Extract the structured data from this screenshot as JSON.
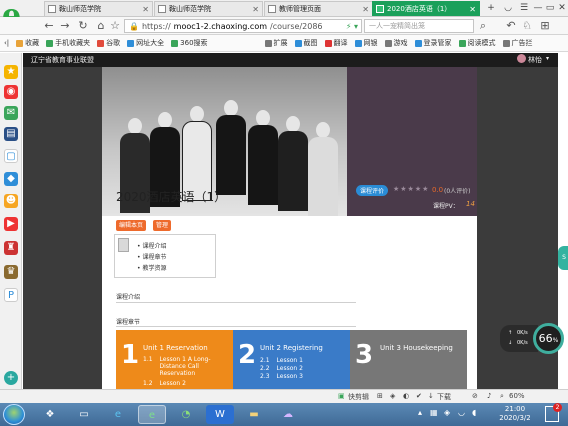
{
  "browser": {
    "tabs": [
      {
        "title": "鞍山师范学院",
        "active": false
      },
      {
        "title": "鞍山师范学院",
        "active": false
      },
      {
        "title": "教师管理页面",
        "active": false
      },
      {
        "title": "2020酒店英语（1）",
        "active": true
      }
    ],
    "window_controls": [
      "+",
      "◡",
      "☰",
      "—",
      "▭",
      "✕"
    ],
    "address": {
      "scheme": "https://",
      "host": "mooc1-2.chaoxing.com",
      "path": "/course/2086",
      "actions": "⚡ ▾"
    },
    "search_placeholder": "一人一宠精简出笼",
    "bookmarks": [
      {
        "label": "收藏",
        "color": "#e8a33a"
      },
      {
        "label": "手机收藏夹",
        "color": "#3aa55a"
      },
      {
        "label": "谷歌",
        "color": "#e14b3c"
      },
      {
        "label": "网址大全",
        "color": "#2f8ed8"
      },
      {
        "label": "360搜索",
        "color": "#3aa55a"
      },
      {
        "label": "扩展",
        "color": "#777777"
      },
      {
        "label": "截图",
        "color": "#2f8ed8"
      },
      {
        "label": "翻译",
        "color": "#d33"
      },
      {
        "label": "网银",
        "color": "#2f8ed8"
      },
      {
        "label": "游戏",
        "color": "#777777"
      },
      {
        "label": "登录管家",
        "color": "#2f8ed8"
      },
      {
        "label": "阅读模式",
        "color": "#3aa55a"
      },
      {
        "label": "广告拦",
        "color": "#777777"
      }
    ]
  },
  "site": {
    "org": "辽宁省教育事业联盟",
    "user": "林怡",
    "user_caret": "▾"
  },
  "course": {
    "title": "2020酒店英语（1）",
    "eval_badge": "课程评价",
    "stars": "★★★★★",
    "score": "0.0",
    "reviews": "(0人评价)",
    "pv_label": "课程PV：",
    "pv_value": "14",
    "edit_btn": "编辑本页",
    "manage_btn": "管理",
    "toc": [
      "• 课程介绍",
      "• 课程章节",
      "• 教学资源"
    ],
    "section_intro": "课程介绍",
    "section_chapters": "课程章节",
    "units": [
      {
        "num": "1",
        "name": "Unit 1 Reservation",
        "color": "#ee8a1a",
        "lessons": [
          {
            "n": "1.1",
            "t": "Lesson 1 A Long-Distance Call Reservation"
          },
          {
            "n": "1.2",
            "t": "Lesson 2"
          }
        ]
      },
      {
        "num": "2",
        "name": "Unit 2 Registering",
        "color": "#3a7bc8",
        "lessons": [
          {
            "n": "2.1",
            "t": "Lesson 1"
          },
          {
            "n": "2.2",
            "t": "Lesson 2"
          },
          {
            "n": "2.3",
            "t": "Lesson 3"
          }
        ]
      },
      {
        "num": "3",
        "name": "Unit 3 Housekeeping",
        "color": "#777777",
        "lessons": []
      }
    ]
  },
  "widgets": {
    "net_up": "0K/s",
    "net_down": "0K/s",
    "gauge": "66",
    "gauge_unit": "%",
    "pill": "S"
  },
  "statusbar": {
    "quick": "快剪辑",
    "download": "下载",
    "zoom": "60%"
  },
  "taskbar": {
    "time": "21:00",
    "date": "2020/3/2",
    "notif_count": "2"
  }
}
